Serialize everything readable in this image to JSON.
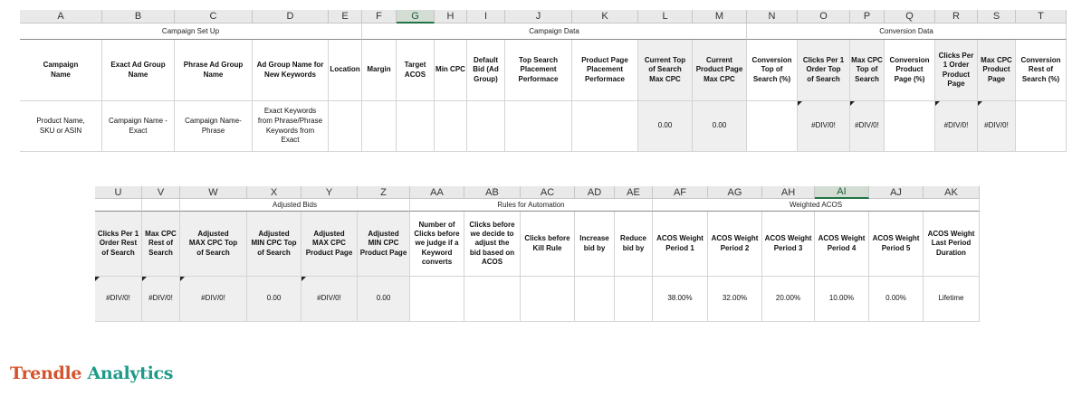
{
  "sheet_top": {
    "columns": [
      {
        "letter": "A",
        "header": "Campaign\nName",
        "value": "Product Name,\nSKU or ASIN"
      },
      {
        "letter": "B",
        "header": "Exact Ad Group\nName",
        "value": "Campaign Name -\nExact"
      },
      {
        "letter": "C",
        "header": "Phrase Ad Group\nName",
        "value": "Campaign Name-\nPhrase"
      },
      {
        "letter": "D",
        "header": "Ad Group Name for\nNew Keywords",
        "value": "Exact Keywords\nfrom Phrase/Phrase\nKeywords from\nExact"
      },
      {
        "letter": "E",
        "header": "Location",
        "value": ""
      },
      {
        "letter": "F",
        "header": "Margin",
        "value": ""
      },
      {
        "letter": "G",
        "header": "Target\nACOS",
        "value": ""
      },
      {
        "letter": "H",
        "header": "Min CPC",
        "value": ""
      },
      {
        "letter": "I",
        "header": "Default\nBid (Ad\nGroup)",
        "value": ""
      },
      {
        "letter": "J",
        "header": "Top Search\nPlacement\nPerformace",
        "value": ""
      },
      {
        "letter": "K",
        "header": "Product Page\nPlacement\nPerformace",
        "value": ""
      },
      {
        "letter": "L",
        "header": "Current Top\nof Search\nMax CPC",
        "value": "0.00"
      },
      {
        "letter": "M",
        "header": "Current\nProduct Page\nMax CPC",
        "value": "0.00"
      },
      {
        "letter": "N",
        "header": "Conversion\nTop of\nSearch (%)",
        "value": ""
      },
      {
        "letter": "O",
        "header": "Clicks Per 1\nOrder Top\nof Search",
        "value": "#DIV/0!"
      },
      {
        "letter": "P",
        "header": "Max CPC\nTop of\nSearch",
        "value": "#DIV/0!"
      },
      {
        "letter": "Q",
        "header": "Conversion\nProduct\nPage (%)",
        "value": ""
      },
      {
        "letter": "R",
        "header": "Clicks Per\n1 Order\nProduct\nPage",
        "value": "#DIV/0!"
      },
      {
        "letter": "S",
        "header": "Max CPC\nProduct\nPage",
        "value": "#DIV/0!"
      },
      {
        "letter": "T",
        "header": "Conversion\nRest of\nSearch (%)",
        "value": ""
      }
    ],
    "groups": [
      "Campaign Set Up",
      "Campaign Data",
      "Conversion Data"
    ]
  },
  "sheet_bottom": {
    "columns": [
      {
        "letter": "U",
        "header": "Clicks Per 1\nOrder Rest\nof Search",
        "value": "#DIV/0!"
      },
      {
        "letter": "V",
        "header": "Max CPC\nRest of\nSearch",
        "value": "#DIV/0!"
      },
      {
        "letter": "W",
        "header": "Adjusted\nMAX CPC Top\nof Search",
        "value": "#DIV/0!"
      },
      {
        "letter": "X",
        "header": "Adjusted\nMIN CPC Top\nof Search",
        "value": "0.00"
      },
      {
        "letter": "Y",
        "header": "Adjusted\nMAX CPC\nProduct Page",
        "value": "#DIV/0!"
      },
      {
        "letter": "Z",
        "header": "Adjusted\nMIN CPC\nProduct Page",
        "value": "0.00"
      },
      {
        "letter": "AA",
        "header": "Number of\nClicks before\nwe judge if a\nKeyword\nconverts",
        "value": ""
      },
      {
        "letter": "AB",
        "header": "Clicks before\nwe decide to\nadjust the\nbid based on\nACOS",
        "value": ""
      },
      {
        "letter": "AC",
        "header": "Clicks before\nKill Rule",
        "value": ""
      },
      {
        "letter": "AD",
        "header": "Increase\nbid by",
        "value": ""
      },
      {
        "letter": "AE",
        "header": "Reduce\nbid by",
        "value": ""
      },
      {
        "letter": "AF",
        "header": "ACOS Weight\nPeriod 1",
        "value": "38.00%"
      },
      {
        "letter": "AG",
        "header": "ACOS Weight\nPeriod 2",
        "value": "32.00%"
      },
      {
        "letter": "AH",
        "header": "ACOS Weight\nPeriod 3",
        "value": "20.00%"
      },
      {
        "letter": "AI",
        "header": "ACOS Weight\nPeriod 4",
        "value": "10.00%"
      },
      {
        "letter": "AJ",
        "header": "ACOS Weight\nPeriod 5",
        "value": "0.00%"
      },
      {
        "letter": "AK",
        "header": "ACOS Weight\nLast Period\nDuration",
        "value": "Lifetime"
      }
    ],
    "groups": [
      "Adjusted Bids",
      "Rules for Automation",
      "Weighted ACOS"
    ]
  },
  "logo": {
    "part1": "Trendle",
    "part2": " Analytics"
  },
  "colors": {
    "header_bg": "#e9e9e9",
    "selected_col": "#217346",
    "gray_cell": "#efefef",
    "logo_orange": "#d4532c",
    "logo_teal": "#1f9a8a"
  }
}
